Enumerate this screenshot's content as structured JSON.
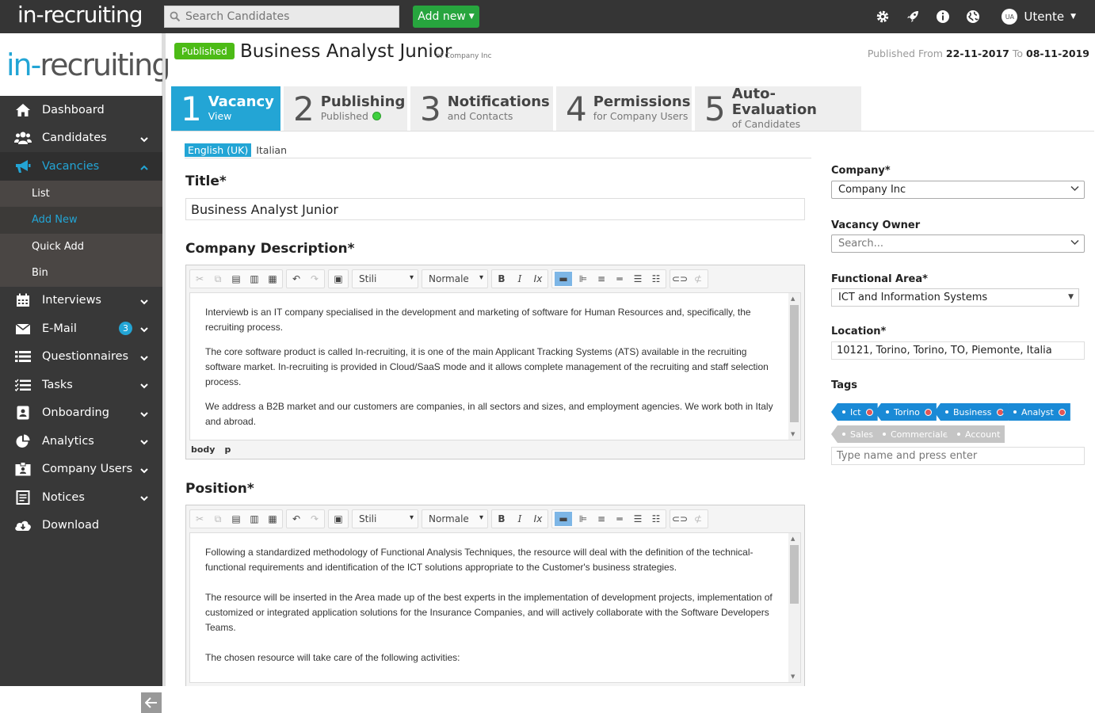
{
  "topbar": {
    "logo": "in-recruiting",
    "search_placeholder": "Search Candidates",
    "add_new_label": "Add new",
    "user_initials": "UA",
    "user_name": "Utente"
  },
  "sidebar": {
    "logo_left": "in-",
    "logo_right": "recruiting",
    "items": [
      {
        "label": "Dashboard",
        "icon": "home-icon"
      },
      {
        "label": "Candidates",
        "icon": "users-icon"
      },
      {
        "label": "Vacancies",
        "icon": "megaphone-icon"
      },
      {
        "label": "Interviews",
        "icon": "calendar-icon"
      },
      {
        "label": "E-Mail",
        "icon": "envelope-icon",
        "badge": "3"
      },
      {
        "label": "Questionnaires",
        "icon": "list-icon"
      },
      {
        "label": "Tasks",
        "icon": "tasks-icon"
      },
      {
        "label": "Onboarding",
        "icon": "onboarding-icon"
      },
      {
        "label": "Analytics",
        "icon": "pie-chart-icon"
      },
      {
        "label": "Company Users",
        "icon": "badge-icon"
      },
      {
        "label": "Notices",
        "icon": "notices-icon"
      },
      {
        "label": "Download",
        "icon": "cloud-download-icon"
      }
    ],
    "vacancies_sub": [
      "List",
      "Add New",
      "Quick Add",
      "Bin"
    ]
  },
  "header": {
    "status": "Published",
    "title": "Business Analyst Junior",
    "subtitle": "of Company Inc",
    "published_from_label": "Published From",
    "published_from": "22-11-2017",
    "to_label": "To",
    "published_to": "08-11-2019"
  },
  "tabs": [
    {
      "num": "1",
      "title": "Vacancy",
      "sub": "View"
    },
    {
      "num": "2",
      "title": "Publishing",
      "sub": "Published"
    },
    {
      "num": "3",
      "title": "Notifications",
      "sub": "and Contacts"
    },
    {
      "num": "4",
      "title": "Permissions",
      "sub": "for Company Users"
    },
    {
      "num": "5",
      "title": "Auto-Evaluation",
      "sub": "of Candidates"
    }
  ],
  "langs": [
    "English (UK)",
    "Italian"
  ],
  "form": {
    "title_label": "Title*",
    "title_value": "Business Analyst Junior",
    "company_desc_label": "Company Description*",
    "position_label": "Position*",
    "styles_combo": "Stili",
    "format_combo": "Normale",
    "statusbar": [
      "body",
      "p"
    ],
    "company_desc": [
      "Interviewb is an IT company specialised in the development and marketing of software for Human Resources and, specifically, the recruiting process.",
      "The core software product is called In-recruiting, it is one of the main Applicant Tracking Systems (ATS) available in the recruiting software market. In-recruiting is provided in Cloud/SaaS mode and it allows complete management of the recruiting and staff selection process.",
      "We address a B2B market and our customers are companies, in all sectors and sizes, and employment agencies. We work both in Italy and abroad."
    ],
    "position_desc": [
      "Following a standardized methodology of Functional Analysis Techniques, the resource will deal with the definition of the technical-functional requirements and identification of the ICT solutions appropriate to the Customer's business strategies.",
      "The resource will be inserted in the Area made up of the best experts in the implementation of development projects, implementation of customized or integrated application solutions for the Insurance Companies, and will actively collaborate with the Software Developers Teams.",
      "The chosen resource will take care of the following activities:"
    ]
  },
  "right": {
    "company_label": "Company*",
    "company_value": "Company Inc",
    "owner_label": "Vacancy Owner",
    "owner_placeholder": "Search...",
    "area_label": "Functional Area*",
    "area_value": "ICT and Information Systems",
    "location_label": "Location*",
    "location_value": "10121, Torino, Torino, TO, Piemonte, Italia",
    "tags_label": "Tags",
    "tags_selected": [
      "Ict",
      "Torino",
      "Business",
      "Analyst"
    ],
    "tags_suggested": [
      "Sales",
      "Commerciale",
      "Account"
    ],
    "tags_placeholder": "Type name and press enter"
  },
  "colors": {
    "accent": "#23a5d5",
    "green": "#27a53e",
    "published": "#4cbb16",
    "tag": "#1a8ad6"
  }
}
